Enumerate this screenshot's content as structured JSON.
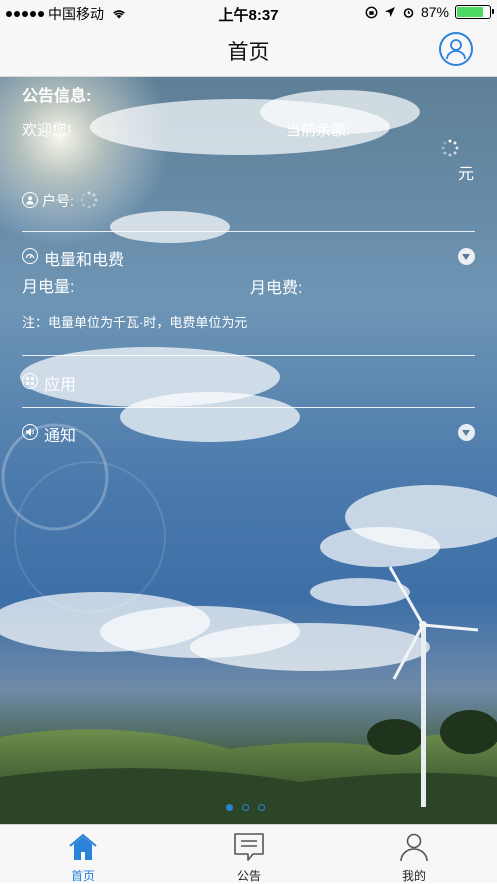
{
  "status_bar": {
    "carrier": "中国移动",
    "time": "上午8:37",
    "battery_percent": "87%",
    "battery_level": 0.87
  },
  "nav": {
    "title": "首页"
  },
  "notice": {
    "title": "公告信息:",
    "welcome": "欢迎您!",
    "balance_label": "当前余额:",
    "balance_unit": "元",
    "account_label": "户号:"
  },
  "sections": {
    "power": {
      "title": "电量和电费",
      "monthly_usage_label": "月电量:",
      "monthly_fee_label": "月电费:",
      "note": "注：电量单位为千瓦·时，电费单位为元"
    },
    "apps": {
      "title": "应用"
    },
    "notify": {
      "title": "通知"
    }
  },
  "pager": {
    "count": 3,
    "active_index": 0
  },
  "tabs": [
    {
      "label": "首页",
      "icon": "home-icon",
      "active": true
    },
    {
      "label": "公告",
      "icon": "message-icon",
      "active": false
    },
    {
      "label": "我的",
      "icon": "person-icon",
      "active": false
    }
  ],
  "colors": {
    "accent": "#2b82d9",
    "battery": "#4cd964"
  }
}
